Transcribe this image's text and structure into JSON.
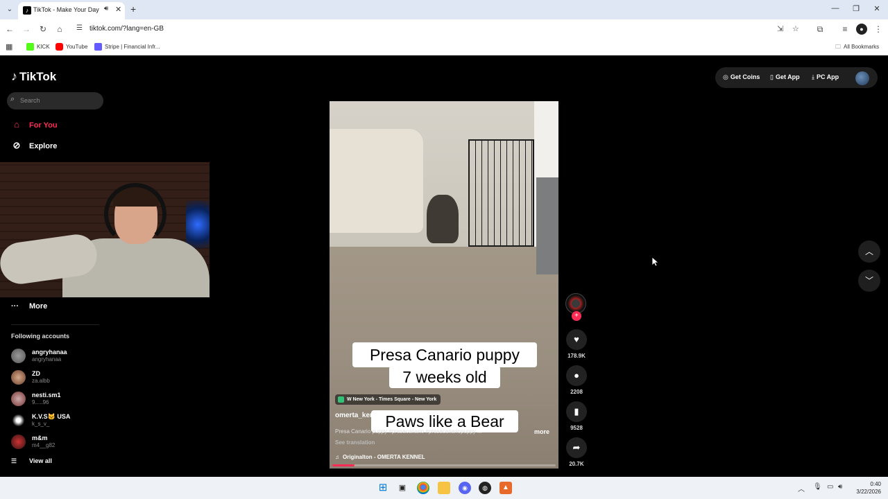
{
  "browser": {
    "tab_title": "TikTok - Make Your Day",
    "url": "tiktok.com/?lang=en-GB",
    "bookmarks": [
      "KICK",
      "YouTube",
      "Stripe | Financial Infr..."
    ],
    "all_bookmarks": "All Bookmarks"
  },
  "sidebar": {
    "logo": "TikTok",
    "search_placeholder": "Search",
    "nav": {
      "for_you": "For You",
      "explore": "Explore",
      "more": "More"
    },
    "following_heading": "Following accounts",
    "accounts": [
      {
        "name": "angryhanaa",
        "handle": "angryhanaa"
      },
      {
        "name": "ZD",
        "handle": "za.albb"
      },
      {
        "name": "nesti.sm1",
        "handle": "9.....96"
      },
      {
        "name": "K.V.S🐱 USA",
        "handle": "k_s_v_"
      },
      {
        "name": "m&m",
        "handle": "m4__g82"
      }
    ],
    "view_all": "View all"
  },
  "header": {
    "get_coins": "Get Coins",
    "get_app": "Get App",
    "pc_app": "PC App"
  },
  "video": {
    "caption_line1": "Presa Canario puppy",
    "caption_line2": "7 weeks old",
    "caption_line3": "Paws like a Bear",
    "location": "W New York - Times Square - New York",
    "username": "omerta_kennel",
    "description": "Presa Canario puppy #presacanario #presacanariopuppy ...",
    "more": "more",
    "see_translation": "See translation",
    "sound": "Originalton - OMERTA KENNEL",
    "progress": 0.1
  },
  "actions": {
    "likes": "178.9K",
    "comments": "2208",
    "saves": "9528",
    "shares": "20.7K"
  },
  "taskbar": {
    "time": "0:40",
    "date": "3/22/2026"
  },
  "colors": {
    "accent": "#fe2c55",
    "background": "#000000"
  }
}
